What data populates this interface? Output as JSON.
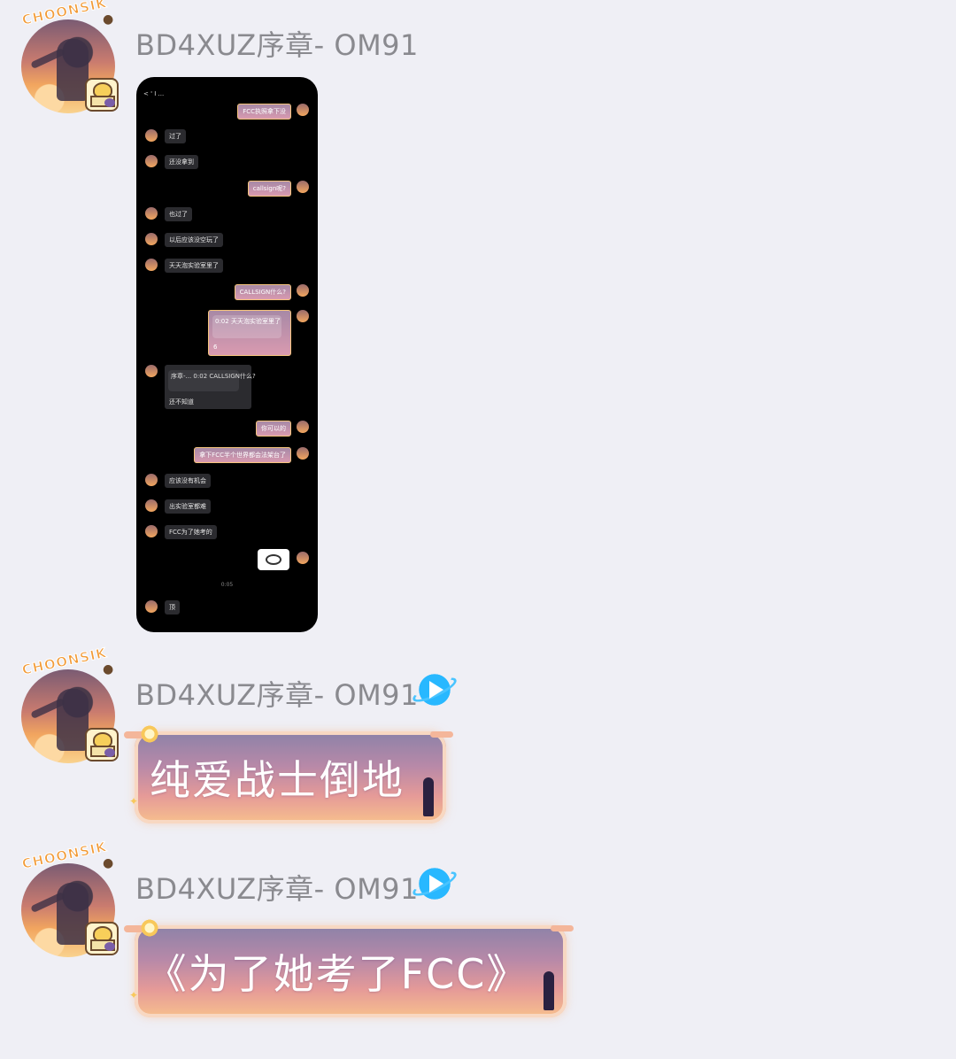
{
  "messages": [
    {
      "avatar_badge": "CHOONSIK",
      "sender": "BD4XUZ序章- OM91",
      "verified": false,
      "type": "image",
      "image": {
        "topbar": "< ' I ...",
        "rows": [
          {
            "side": "right",
            "text": "FCC执照拿下没"
          },
          {
            "side": "left",
            "text": "过了"
          },
          {
            "side": "left",
            "text": "还没拿到"
          },
          {
            "side": "right",
            "text": "callsign呢?"
          },
          {
            "side": "left",
            "text": "也过了"
          },
          {
            "side": "left",
            "text": "以后应该没空玩了"
          },
          {
            "side": "left",
            "text": "天天泡实验室里了"
          },
          {
            "side": "right",
            "text": "CALLSIGN什么?"
          },
          {
            "side": "right",
            "text": "6",
            "quote": "0:02 天天泡实验室里了"
          },
          {
            "side": "left",
            "text": "还不知道",
            "quote": "序章-... 0:02 CALLSIGN什么?"
          },
          {
            "side": "right",
            "text": "你可以的"
          },
          {
            "side": "right",
            "text": "拿下FCC半个世界都会法架台了"
          },
          {
            "side": "left",
            "text": "应该没有机会"
          },
          {
            "side": "left",
            "text": "出实验室都难"
          },
          {
            "side": "left",
            "text": "FCC为了她考的"
          },
          {
            "side": "left",
            "text": "顶"
          }
        ],
        "timestamp": "0:05"
      }
    },
    {
      "avatar_badge": "CHOONSIK",
      "sender": "BD4XUZ序章- OM91",
      "verified": true,
      "type": "text",
      "text": "纯爱战士倒地"
    },
    {
      "avatar_badge": "CHOONSIK",
      "sender": "BD4XUZ序章- OM91",
      "verified": true,
      "type": "text",
      "text": "《为了她考了FCC》"
    }
  ],
  "colors": {
    "background": "#efeff5",
    "sender_name": "#8a8a8f",
    "bubble_top": "#8c82a8",
    "bubble_bottom": "#f7c08d",
    "verified": "#28b8ff"
  }
}
